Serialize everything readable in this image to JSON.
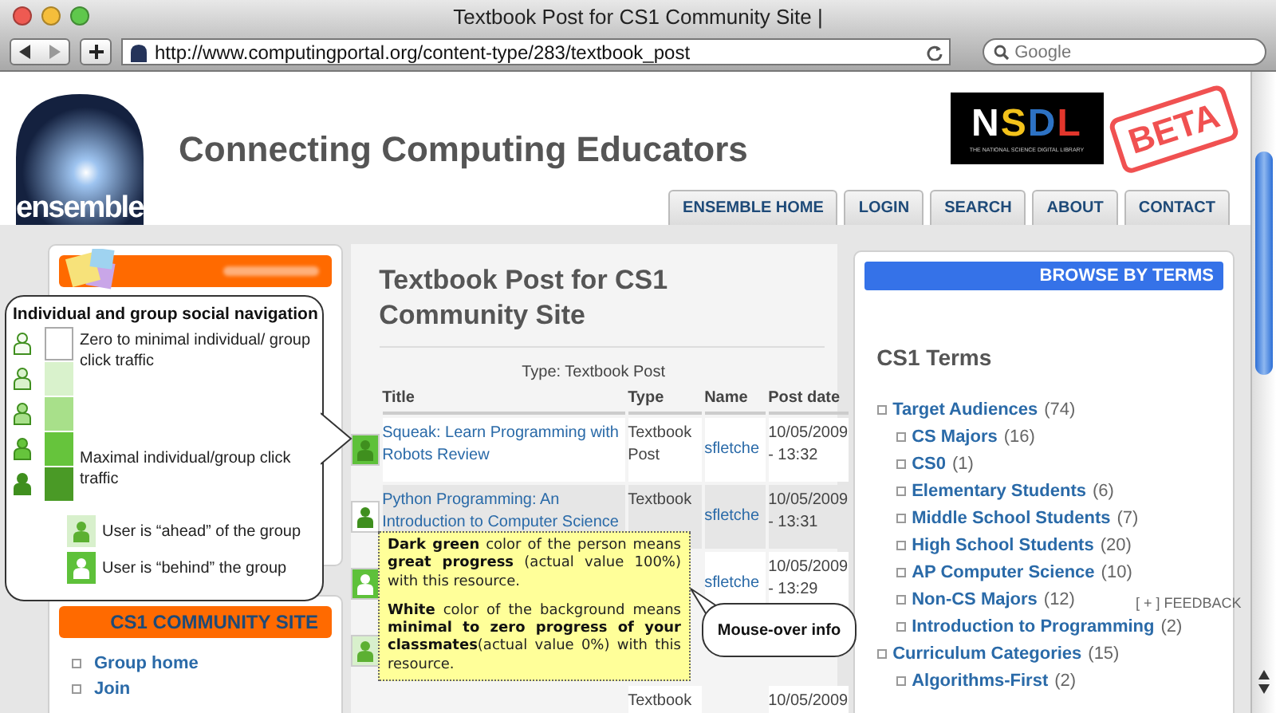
{
  "window": {
    "title": "Textbook Post for CS1 Community Site |"
  },
  "toolbar": {
    "url": "http://www.computingportal.org/content-type/283/textbook_post",
    "search_placeholder": "Google"
  },
  "header": {
    "logo_text": "ensemble",
    "heading": "Connecting Computing Educators",
    "nsdl": {
      "letters": "NSDL",
      "tagline": "THE NATIONAL SCIENCE DIGITAL LIBRARY"
    },
    "stamp": "BETA",
    "tabs": [
      "ENSEMBLE HOME",
      "LOGIN",
      "SEARCH",
      "ABOUT",
      "CONTACT"
    ]
  },
  "left_sidebar": {
    "group_title": "CS1 COMMUNITY SITE",
    "links": [
      "Group home",
      "Join"
    ]
  },
  "content": {
    "title": "Textbook Post for CS1 Community Site",
    "caption": "Type: Textbook Post",
    "columns": [
      "Title",
      "Type",
      "Name",
      "Post date"
    ],
    "rows": [
      {
        "figure": {
          "color": "#3f8f1e"
        },
        "color": "#5ec13a",
        "title": "Squeak: Learn Programming with Robots Review",
        "type": "Textbook Post",
        "name": "sfletche",
        "date": "10/05/2009 - 13:32"
      },
      {
        "figure": {
          "color": "#3f8f1e"
        },
        "color": "#ffffff",
        "title": "Python Programming:  An Introduction to Computer Science",
        "type": "Textbook",
        "name": "sfletche",
        "date": "10/05/2009 - 13:31"
      },
      {
        "figure": {
          "color": "#ffffff"
        },
        "color": "#5ec13a",
        "name": "sfletche",
        "date": "10/05/2009 - 13:29"
      },
      {
        "figure": {
          "color": "#5cb032"
        },
        "color": "#d8f0cc"
      },
      {
        "type": "Textbook",
        "date": "10/05/2009"
      }
    ]
  },
  "right_sidebar": {
    "header": "BROWSE BY TERMS",
    "heading": "CS1 Terms",
    "terms": [
      {
        "label": "Target Audiences",
        "count": "(74)",
        "children": [
          {
            "label": "CS Majors",
            "count": "(16)"
          },
          {
            "label": "CS0",
            "count": "(1)"
          },
          {
            "label": "Elementary Students",
            "count": "(6)"
          },
          {
            "label": "Middle School Students",
            "count": "(7)"
          },
          {
            "label": "High School Students",
            "count": "(20)"
          },
          {
            "label": "AP Computer Science",
            "count": "(10)"
          },
          {
            "label": "Non-CS Majors",
            "count": "(12)"
          },
          {
            "label": "Introduction to Programming",
            "count": "(2)"
          }
        ]
      },
      {
        "label": "Curriculum Categories",
        "count": "(15)",
        "children": [
          {
            "label": "Algorithms-First",
            "count": "(2)"
          }
        ]
      }
    ]
  },
  "feedback": "[ + ] FEEDBACK",
  "legend": {
    "title": "Individual and group social navigation",
    "levels": [
      {
        "figure": {
          "color": "#f4fbf0"
        },
        "color": "#ffffff",
        "label": "Zero to minimal individual/ group click traffic"
      },
      {
        "figure": {
          "color": "#d9f2cc"
        },
        "color": "#d9f2cc"
      },
      {
        "figure": {
          "color": "#a8e08a"
        },
        "color": "#a8e08a"
      },
      {
        "figure": {
          "color": "#66c43c"
        },
        "color": "#66c43c",
        "label": "Maximal individual/group click traffic"
      },
      {
        "figure": {
          "color": "#3f8f1e"
        },
        "color": "#4a9a26"
      }
    ],
    "statuses": [
      {
        "label": "User is “ahead” of the group",
        "figure": {
          "color": "#5cb032"
        },
        "color": "#d8f0cc"
      },
      {
        "label": "User is “behind” the group",
        "figure": {
          "color": "#ffffff"
        },
        "color": "#5ec13a"
      }
    ]
  },
  "tooltip": {
    "paragraphs": [
      "**Dark green** color of the person means **great progress** (actual value 100%) with this resource.",
      "**White** color of the background means **minimal to zero progress of your classmates**(actual value 0%) with this resource."
    ]
  },
  "callout": "Mouse-over info"
}
